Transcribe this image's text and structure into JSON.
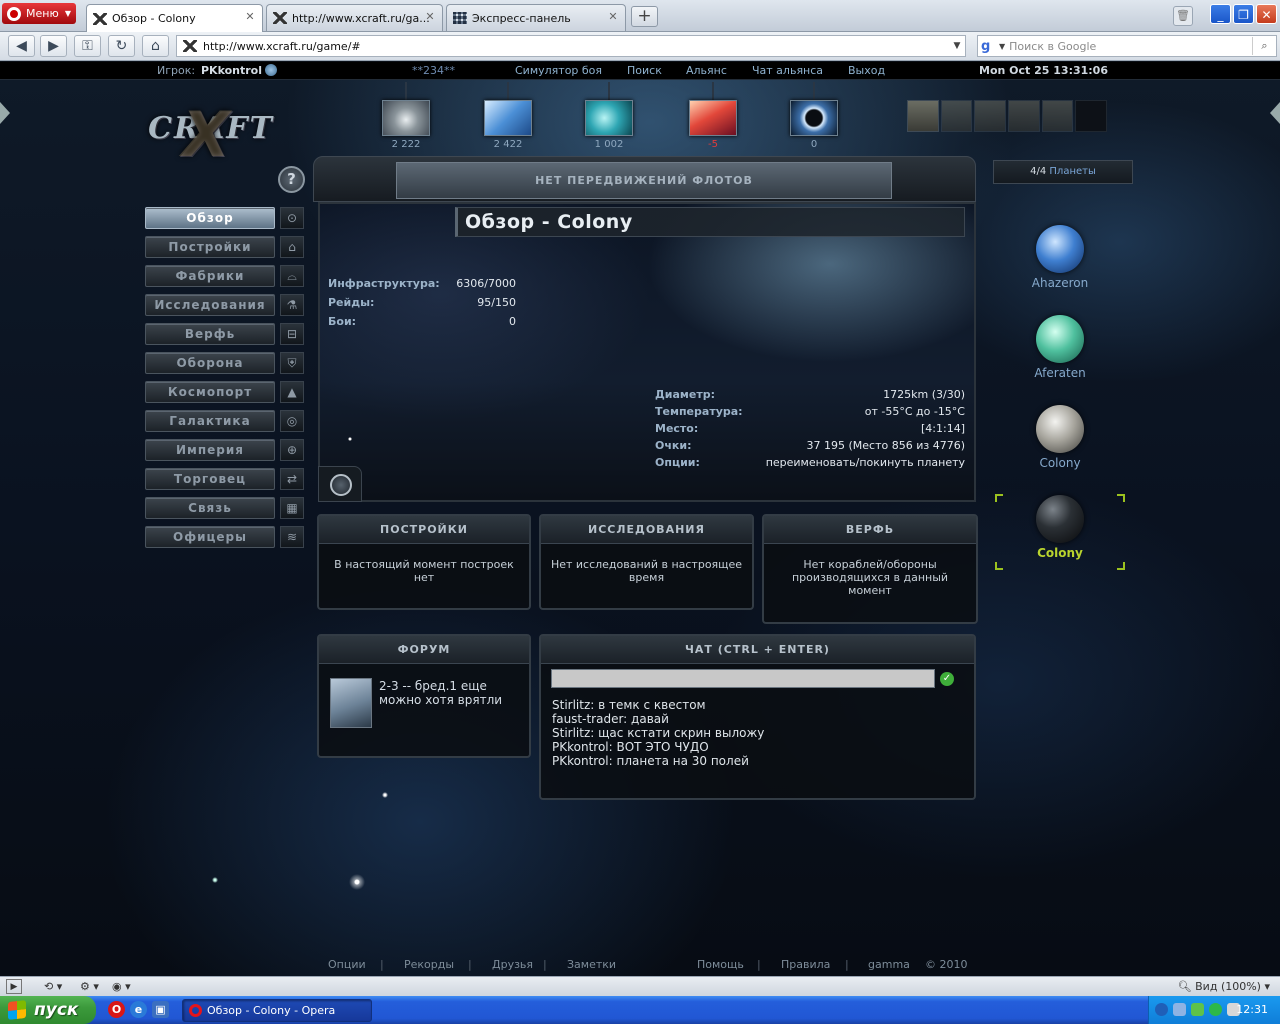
{
  "browser": {
    "menu_label": "Меню",
    "tabs": [
      {
        "title": "Обзор - Colony",
        "icon": "xcraft-favicon",
        "active": true
      },
      {
        "title": "http://www.xcraft.ru/ga...",
        "icon": "xcraft-favicon",
        "active": false
      },
      {
        "title": "Экспресс-панель",
        "icon": "speed-dial-icon",
        "active": false
      }
    ],
    "new_tab_label": "+",
    "url": "http://www.xcraft.ru/game/#",
    "search_placeholder": "Поиск в Google",
    "search_engine_letter": "g"
  },
  "game": {
    "topbar": {
      "player_label": "Игрок:",
      "player_name": "PKkontrol",
      "stars": "**234**",
      "links": [
        "Симулятор боя",
        "Поиск",
        "Альянс",
        "Чат альянса",
        "Выход"
      ],
      "datetime": "Mon Oct 25 13:31:06"
    },
    "logo_text": "CRAFT",
    "logo_mark": "X",
    "resources": [
      {
        "name": "metal",
        "value": "2 222",
        "negative": false
      },
      {
        "name": "crystal",
        "value": "2 422",
        "negative": false
      },
      {
        "name": "deuterium",
        "value": "1 002",
        "negative": false
      },
      {
        "name": "energy",
        "value": "-5",
        "negative": true
      },
      {
        "name": "dark-matter",
        "value": "0",
        "negative": false
      }
    ],
    "help_label": "?",
    "menu": [
      {
        "label": "Обзор",
        "active": true,
        "icon": "⊙"
      },
      {
        "label": "Постройки",
        "active": false,
        "icon": "⌂"
      },
      {
        "label": "Фабрики",
        "active": false,
        "icon": "⌓"
      },
      {
        "label": "Исследования",
        "active": false,
        "icon": "⚗"
      },
      {
        "label": "Верфь",
        "active": false,
        "icon": "⊟"
      },
      {
        "label": "Оборона",
        "active": false,
        "icon": "⛨"
      },
      {
        "label": "Космопорт",
        "active": false,
        "icon": "▲"
      },
      {
        "label": "Галактика",
        "active": false,
        "icon": "◎"
      },
      {
        "label": "Империя",
        "active": false,
        "icon": "⊕"
      },
      {
        "label": "Торговец",
        "active": false,
        "icon": "⇄"
      },
      {
        "label": "Связь",
        "active": false,
        "icon": "▦"
      },
      {
        "label": "Офицеры",
        "active": false,
        "icon": "≋"
      }
    ],
    "fleet_status": "НЕТ ПЕРЕДВИЖЕНИЙ ФЛОТОВ",
    "planets_count": "4/4",
    "planets_label": "Планеты",
    "overview": {
      "title": "Обзор - Colony",
      "stats_left": [
        {
          "label": "Инфраструктура:",
          "value": "6306/7000"
        },
        {
          "label": "Рейды:",
          "value": "95/150"
        },
        {
          "label": "Бои:",
          "value": "0"
        }
      ],
      "stats_right": [
        {
          "label": "Диаметр:",
          "value": "1725km (3/30)"
        },
        {
          "label": "Температура:",
          "value": "от -55°C до -15°C"
        },
        {
          "label": "Место:",
          "value": "[4:1:14]"
        },
        {
          "label": "Очки:",
          "value": "37 195 (Место 856 из 4776)"
        },
        {
          "label": "Опции:",
          "value": "переименовать/покинуть планету"
        }
      ]
    },
    "panels": {
      "buildings": {
        "title": "ПОСТРОЙКИ",
        "text": "В настоящий момент построек нет"
      },
      "research": {
        "title": "ИССЛЕДОВАНИЯ",
        "text": "Нет исследований в настроящее время"
      },
      "shipyard": {
        "title": "ВЕРФЬ",
        "text": "Нет кораблей/обороны производящихся в данный момент"
      },
      "forum": {
        "title": "ФОРУМ",
        "post": "2-3 -- бред.1 еще можно хотя врятли"
      },
      "chat": {
        "title": "ЧАТ (CTRL + ENTER)",
        "send_label": "✓",
        "messages": [
          "Stirlitz: в темк с квестом",
          "faust-trader: давай",
          "Stirlitz: щас кстати скрин выложу",
          "PKkontrol: ВОТ ЭТО ЧУДО",
          "PKkontrol: планета на 30 полей"
        ]
      }
    },
    "planets": [
      {
        "name": "Ahazeron",
        "current": false
      },
      {
        "name": "Aferaten",
        "current": false
      },
      {
        "name": "Colony",
        "current": false
      },
      {
        "name": "Colony",
        "current": true
      }
    ],
    "footer": {
      "links": [
        "Опции",
        "Рекорды",
        "Друзья",
        "Заметки",
        "Помощь",
        "Правила",
        "gamma"
      ],
      "separator": "|",
      "copyright": "© 2010"
    }
  },
  "statusbar": {
    "zoom": "Вид (100%)"
  },
  "taskbar": {
    "start_label": "пуск",
    "task_title": "Обзор - Colony - Opera",
    "time": "12:31"
  },
  "colors": {
    "accent_current_planet": "#b9d42e",
    "negative_value": "#e03b3b",
    "link_blue": "#86a9cc"
  }
}
